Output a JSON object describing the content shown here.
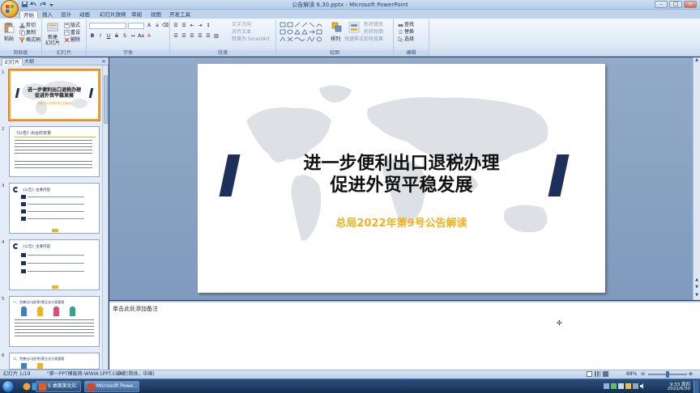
{
  "window": {
    "title": "公告解读 6.30.pptx - Microsoft PowerPoint",
    "min": "–",
    "max": "□",
    "close": "×"
  },
  "tabs": [
    {
      "label": "开始",
      "active": true
    },
    {
      "label": "插入"
    },
    {
      "label": "设计"
    },
    {
      "label": "动画"
    },
    {
      "label": "幻灯片放映"
    },
    {
      "label": "审阅"
    },
    {
      "label": "视图"
    },
    {
      "label": "开发工具"
    }
  ],
  "ribbon": {
    "clipboard": {
      "paste": "粘贴",
      "cut": "剪切",
      "copy": "复制",
      "format_painter": "格式刷",
      "label": "剪贴板"
    },
    "slides": {
      "new_slide": "新建\n幻灯片",
      "layout": "版式",
      "reset": "重设",
      "delete": "删除",
      "label": "幻灯片"
    },
    "font": {
      "label": "字体"
    },
    "paragraph": {
      "text_direction": "文字方向",
      "align_text": "对齐文本",
      "smartart": "转换为 SmartArt",
      "label": "段落"
    },
    "drawing": {
      "arrange": "排列",
      "quick_styles": "快速样式",
      "shape_fill": "形状填充",
      "shape_outline": "形状轮廓",
      "shape_effects": "形状效果",
      "label": "绘图"
    },
    "editing": {
      "find": "查找",
      "replace": "替换",
      "select": "选择",
      "label": "编辑"
    }
  },
  "left_pane": {
    "tab_slides": "幻灯片",
    "tab_outline": "大纲",
    "close": "×",
    "thumbnails": [
      {
        "num": "1",
        "title": "进一步便利出口退税办理\n促进外贸平稳发展",
        "subtitle": "总局2022年第9号公告解读"
      },
      {
        "num": "2",
        "title": "《公告》出台的背景"
      },
      {
        "num": "3",
        "title": "《公告》主要内容"
      },
      {
        "num": "4",
        "title": "《公告》主要内容"
      },
      {
        "num": "5",
        "title": "一、完善出口退(免)税企业分类管理"
      },
      {
        "num": "6",
        "title": "二、完善出口退(免)税企业分类管理"
      }
    ]
  },
  "slide": {
    "title_line1": "进一步便利出口退税办理",
    "title_line2": "促进外贸平稳发展",
    "subtitle": "总局2022年第9号公告解读"
  },
  "notes": {
    "placeholder": "单击此处添加备注"
  },
  "status": {
    "slide_count": "幻灯片 1/19",
    "theme": "\"第一PPT模板网-WWW.1PPT.COM\"",
    "language": "中文(简体，中国)",
    "zoom": "88%"
  },
  "taskbar": {
    "item1": "S 桌面美化栏",
    "item2": "Microsoft Powe...",
    "time": "9:33 周四",
    "date": "2022/6/30"
  },
  "colors": {
    "navy": "#1f2f5c",
    "gold": "#f0b21e",
    "ribbon": "#dfe9f6",
    "accent": "#f1a33a"
  }
}
